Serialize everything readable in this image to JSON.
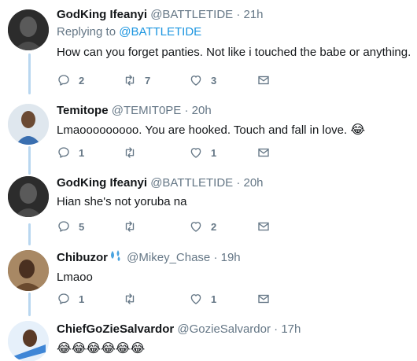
{
  "tweets": [
    {
      "display_name": "GodKing Ifeanyi",
      "handle": "@BATTLETIDE",
      "separator": "·",
      "time": "21h",
      "replying_prefix": "Replying to",
      "replying_to": "@BATTLETIDE",
      "text": "How can you forget panties. Not like i touched the babe or anything.",
      "reply_count": "2",
      "retweet_count": "7",
      "like_count": "3"
    },
    {
      "display_name": "Temitope",
      "handle": "@TEMIT0PE",
      "separator": "·",
      "time": "20h",
      "text": "Lmaooooooooo. You are hooked. Touch and fall in love.",
      "text_emoji": "😂",
      "reply_count": "1",
      "retweet_count": "",
      "like_count": "1"
    },
    {
      "display_name": "GodKing Ifeanyi",
      "handle": "@BATTLETIDE",
      "separator": "·",
      "time": "20h",
      "text": "Hian she's not yoruba na",
      "reply_count": "5",
      "retweet_count": "",
      "like_count": "2"
    },
    {
      "display_name": "Chibuzor",
      "handle": "@Mikey_Chase",
      "separator": "·",
      "time": "19h",
      "text": "Lmaoo",
      "reply_count": "1",
      "retweet_count": "",
      "like_count": "1"
    },
    {
      "display_name": "ChiefGoZieSalvardor",
      "handle": "@GozieSalvardor",
      "separator": "·",
      "time": "17h",
      "text_emoji": "😂😂😂😂😂😂"
    }
  ],
  "icons": {
    "reply": "reply-icon",
    "retweet": "retweet-icon",
    "like": "heart-icon",
    "message": "envelope-icon"
  },
  "colors": {
    "link": "#1b95e0",
    "secondary_text": "#657786",
    "thread_line": "#b9d7f0"
  }
}
